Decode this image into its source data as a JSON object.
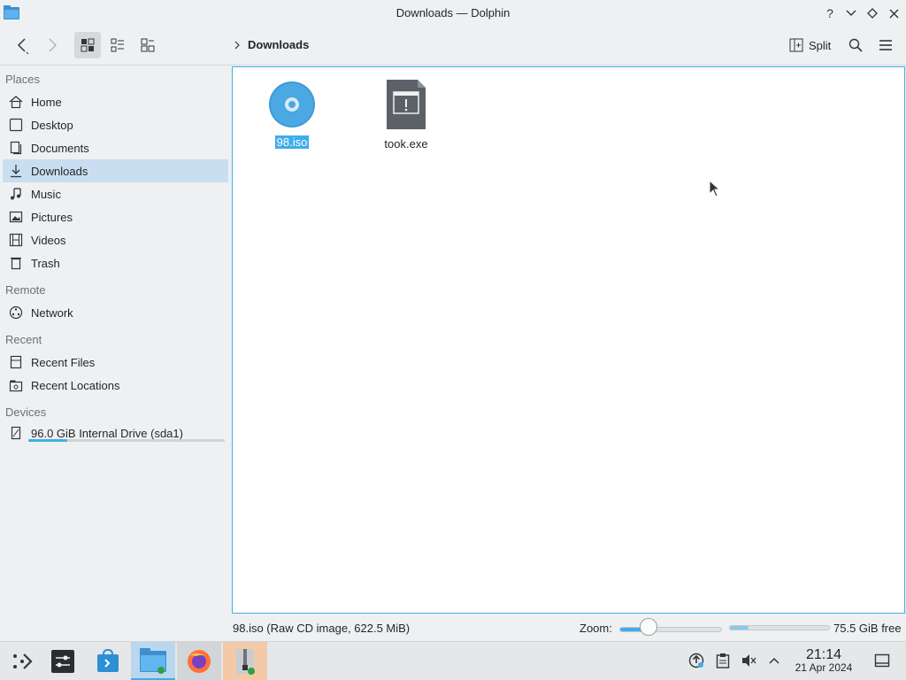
{
  "window": {
    "title": "Downloads — Dolphin",
    "controls": [
      "help-icon",
      "minimize-icon",
      "maximize-icon",
      "close-icon"
    ]
  },
  "toolbar": {
    "breadcrumb": "Downloads",
    "split_label": "Split"
  },
  "sidebar": {
    "sections": {
      "places": "Places",
      "remote": "Remote",
      "recent": "Recent",
      "devices": "Devices"
    },
    "places": [
      {
        "label": "Home",
        "icon": "home-icon"
      },
      {
        "label": "Desktop",
        "icon": "desktop-icon"
      },
      {
        "label": "Documents",
        "icon": "documents-icon"
      },
      {
        "label": "Downloads",
        "icon": "downloads-icon",
        "selected": true
      },
      {
        "label": "Music",
        "icon": "music-icon"
      },
      {
        "label": "Pictures",
        "icon": "pictures-icon"
      },
      {
        "label": "Videos",
        "icon": "videos-icon"
      },
      {
        "label": "Trash",
        "icon": "trash-icon"
      }
    ],
    "remote": [
      {
        "label": "Network",
        "icon": "network-icon"
      }
    ],
    "recent": [
      {
        "label": "Recent Files",
        "icon": "recent-files-icon"
      },
      {
        "label": "Recent Locations",
        "icon": "recent-locations-icon"
      }
    ],
    "devices": [
      {
        "label": "96.0 GiB Internal Drive (sda1)",
        "icon": "drive-icon",
        "usage_fraction": 0.2
      }
    ]
  },
  "files": [
    {
      "name": "98.iso",
      "icon": "disc-image-icon",
      "selected": true
    },
    {
      "name": "took.exe",
      "icon": "executable-icon",
      "selected": false
    }
  ],
  "statusbar": {
    "selection_info": "98.iso (Raw CD image, 622.5 MiB)",
    "zoom_label": "Zoom:",
    "zoom_fraction": 0.28,
    "free_space": "75.5 GiB free",
    "used_fraction": 0.19
  },
  "taskbar": {
    "apps": [
      "application-launcher-icon",
      "system-settings-icon",
      "discover-icon",
      "dolphin-icon",
      "firefox-icon",
      "archive-manager-icon"
    ],
    "tray": [
      "updates-icon",
      "clipboard-icon",
      "volume-muted-icon",
      "expand-tray-icon"
    ],
    "time": "21:14",
    "date": "21 Apr 2024"
  },
  "colors": {
    "accent": "#3daee9",
    "selection": "#c9def1"
  }
}
